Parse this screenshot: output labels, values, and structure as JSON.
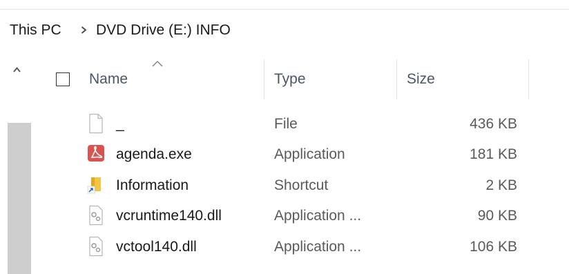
{
  "breadcrumb": {
    "items": [
      "This PC",
      "DVD Drive (E:) INFO"
    ]
  },
  "columns": {
    "name": "Name",
    "type": "Type",
    "size": "Size"
  },
  "files": [
    {
      "name": "_",
      "type": "File",
      "size": "436 KB",
      "icon": "blank-file-icon"
    },
    {
      "name": "agenda.exe",
      "type": "Application",
      "size": "181 KB",
      "icon": "pdf-app-icon"
    },
    {
      "name": "Information",
      "type": "Shortcut",
      "size": "2 KB",
      "icon": "folder-shortcut-icon"
    },
    {
      "name": "vcruntime140.dll",
      "type": "Application ...",
      "size": "90 KB",
      "icon": "dll-file-icon"
    },
    {
      "name": "vctool140.dll",
      "type": "Application ...",
      "size": "106 KB",
      "icon": "dll-file-icon"
    }
  ],
  "colors": {
    "accent_red": "#d9534f",
    "folder_yellow": "#f4c542",
    "shortcut_blue": "#1f6fd1",
    "scroll_thumb": "#cdcdcd"
  }
}
